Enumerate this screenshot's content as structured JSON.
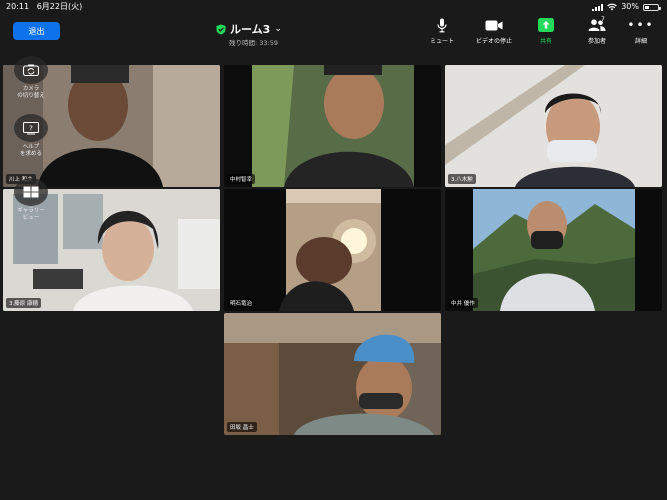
{
  "status": {
    "time": "20:11",
    "date": "6月22日(火)",
    "battery": "30%",
    "battery_level": 0.3
  },
  "header": {
    "leave_label": "退出",
    "room_name": "ルーム3",
    "timer": "残り時間: 33:59",
    "toolbar": {
      "mute": "ミュート",
      "video": "ビデオの停止",
      "share": "共有",
      "participants": "参加者",
      "participants_count": "7",
      "more": "詳細"
    }
  },
  "side_tools": {
    "camera": "カメラ\nの切り替え",
    "help": "ヘルプ\nを求める",
    "layout": "ギャラリー\nビュー"
  },
  "participants": [
    {
      "name": "川上 和夫"
    },
    {
      "name": "中村智幸"
    },
    {
      "name": "3.八木勲"
    },
    {
      "name": "3.藤原 康穂"
    },
    {
      "name": "明石竜治"
    },
    {
      "name": "中井 優作"
    },
    {
      "name": "田坂 昌士"
    }
  ],
  "colors": {
    "leave_button": "#0e72ed",
    "share_icon": "#23d959",
    "active_border": "#23d959",
    "background": "#1a1a1a"
  }
}
